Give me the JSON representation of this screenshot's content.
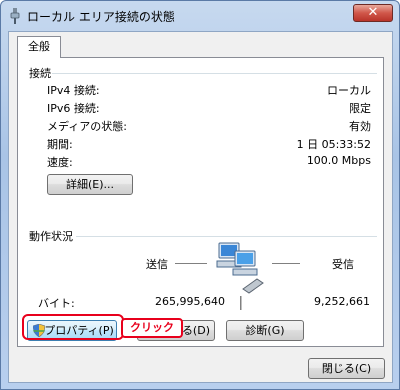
{
  "window": {
    "title": "ローカル エリア接続の状態",
    "close_glyph": "✕"
  },
  "tabs": [
    {
      "label": "全般"
    }
  ],
  "connection": {
    "heading": "接続",
    "rows": [
      {
        "label": "IPv4 接続:",
        "value": "ローカル"
      },
      {
        "label": "IPv6 接続:",
        "value": "限定"
      },
      {
        "label": "メディアの状態:",
        "value": "有効"
      },
      {
        "label": "期間:",
        "value": "1 日 05:33:52"
      },
      {
        "label": "速度:",
        "value": "100.0 Mbps"
      }
    ],
    "details_button": "詳細(E)..."
  },
  "activity": {
    "heading": "動作状況",
    "sent_label": "送信",
    "received_label": "受信",
    "bytes_label": "バイト:",
    "bytes_sent": "265,995,640",
    "bytes_received": "9,252,661"
  },
  "buttons": {
    "properties": "プロパティ(P)",
    "disable": "無効にする(D)",
    "disable_visible": "る(D)",
    "diagnose": "診断(G)",
    "close": "閉じる(C)"
  },
  "annotation": {
    "callout": "クリック",
    "color": "#e8001c"
  },
  "icons": {
    "title": "network-plug-icon",
    "properties": "shield-icon",
    "activity": "network-computers-icon"
  }
}
